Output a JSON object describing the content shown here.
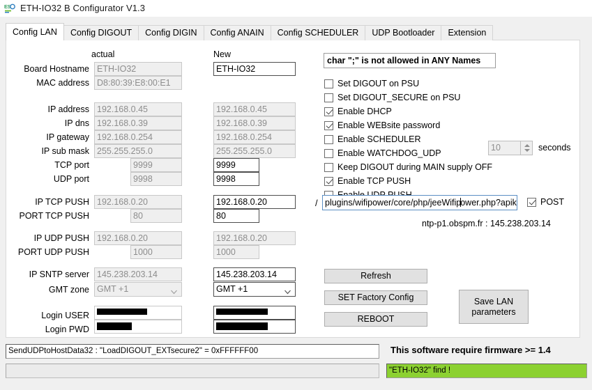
{
  "window": {
    "title": "ETH-IO32 B Configurator V1.3",
    "icon": "app-logo-icon"
  },
  "tabs": [
    {
      "label": "Config LAN",
      "active": true
    },
    {
      "label": "Config DIGOUT",
      "active": false
    },
    {
      "label": "Config DIGIN",
      "active": false
    },
    {
      "label": "Config ANAIN",
      "active": false
    },
    {
      "label": "Config SCHEDULER",
      "active": false
    },
    {
      "label": "UDP Bootloader",
      "active": false
    },
    {
      "label": "Extension",
      "active": false
    }
  ],
  "columns": {
    "actual": "actual",
    "new": "New"
  },
  "labels": {
    "board_hostname": "Board Hostname",
    "mac_address": "MAC address",
    "ip_address": "IP address",
    "ip_dns": "IP dns",
    "ip_gateway": "IP gateway",
    "ip_sub_mask": "IP sub mask",
    "tcp_port": "TCP port",
    "udp_port": "UDP port",
    "ip_tcp_push": "IP TCP PUSH",
    "port_tcp_push": "PORT TCP PUSH",
    "ip_udp_push": "IP UDP PUSH",
    "port_udp_push": "PORT UDP PUSH",
    "ip_sntp_server": "IP SNTP server",
    "gmt_zone": "GMT zone",
    "login_user": "Login USER",
    "login_pwd": "Login PWD",
    "seconds": "seconds"
  },
  "actual": {
    "board_hostname": "ETH-IO32",
    "mac_address": "D8:80:39:E8:00:E1",
    "ip_address": "192.168.0.45",
    "ip_dns": "192.168.0.39",
    "ip_gateway": "192.168.0.254",
    "ip_sub_mask": "255.255.255.0",
    "tcp_port": "9999",
    "udp_port": "9998",
    "ip_tcp_push": "192.168.0.20",
    "port_tcp_push": "80",
    "ip_udp_push": "192.168.0.20",
    "port_udp_push": "1000",
    "ip_sntp_server": "145.238.203.14",
    "gmt_zone": "GMT +1",
    "login_user": "",
    "login_pwd": ""
  },
  "new": {
    "board_hostname": "ETH-IO32",
    "ip_address": "192.168.0.45",
    "ip_dns": "192.168.0.39",
    "ip_gateway": "192.168.0.254",
    "ip_sub_mask": "255.255.255.0",
    "tcp_port": "9999",
    "udp_port": "9998",
    "ip_tcp_push": "192.168.0.20",
    "port_tcp_push": "80",
    "ip_udp_push": "192.168.0.20",
    "port_udp_push": "1000",
    "ip_sntp_server": "145.238.203.14",
    "gmt_zone": "GMT +1",
    "login_user": "",
    "login_pwd": ""
  },
  "warning": "char \";\" is not allowed in ANY Names",
  "checkboxes": [
    {
      "label": "Set DIGOUT on PSU",
      "checked": false
    },
    {
      "label": "Set DIGOUT_SECURE on PSU",
      "checked": false
    },
    {
      "label": "Enable DHCP",
      "checked": true
    },
    {
      "label": "Enable WEBsite password",
      "checked": true
    },
    {
      "label": "Enable SCHEDULER",
      "checked": false
    },
    {
      "label": "Enable WATCHDOG_UDP",
      "checked": false
    },
    {
      "label": "Keep DIGOUT during MAIN supply OFF",
      "checked": false
    },
    {
      "label": "Enable TCP PUSH",
      "checked": true
    },
    {
      "label": "Enable UDP PUSH",
      "checked": false
    }
  ],
  "watchdog": {
    "value": "10",
    "unit": "seconds"
  },
  "push_url": {
    "prefix": "/",
    "value_before_caret": "plugins/wifipower/core/php/jeeWifip",
    "value_after_caret": "ower.php?apik",
    "full_value": "plugins/wifipower/core/php/jeeWifipower.php?apik",
    "post_label": "POST",
    "post_checked": true
  },
  "ntp_note": "ntp-p1.obspm.fr : 145.238.203.14",
  "buttons": {
    "refresh": "Refresh",
    "factory": "SET Factory Config",
    "reboot": "REBOOT",
    "save_lan_line1": "Save LAN",
    "save_lan_line2": "parameters"
  },
  "status": {
    "log": "SendUDPtoHostData32 : \"LoadDIGOUT_EXTsecure2\" = 0xFFFFFF00",
    "log2": "",
    "firmware_note": "This software require firmware >= 1.4",
    "find": "\"ETH-IO32\" find !"
  },
  "colors": {
    "find_bar": "#8cd131",
    "window_bg": "#f0f0f0",
    "panel_bg": "#ffffff",
    "button_bg": "#e1e1e1",
    "disabled_text": "#8d8d8d",
    "focus_border": "#5a8ec4"
  }
}
